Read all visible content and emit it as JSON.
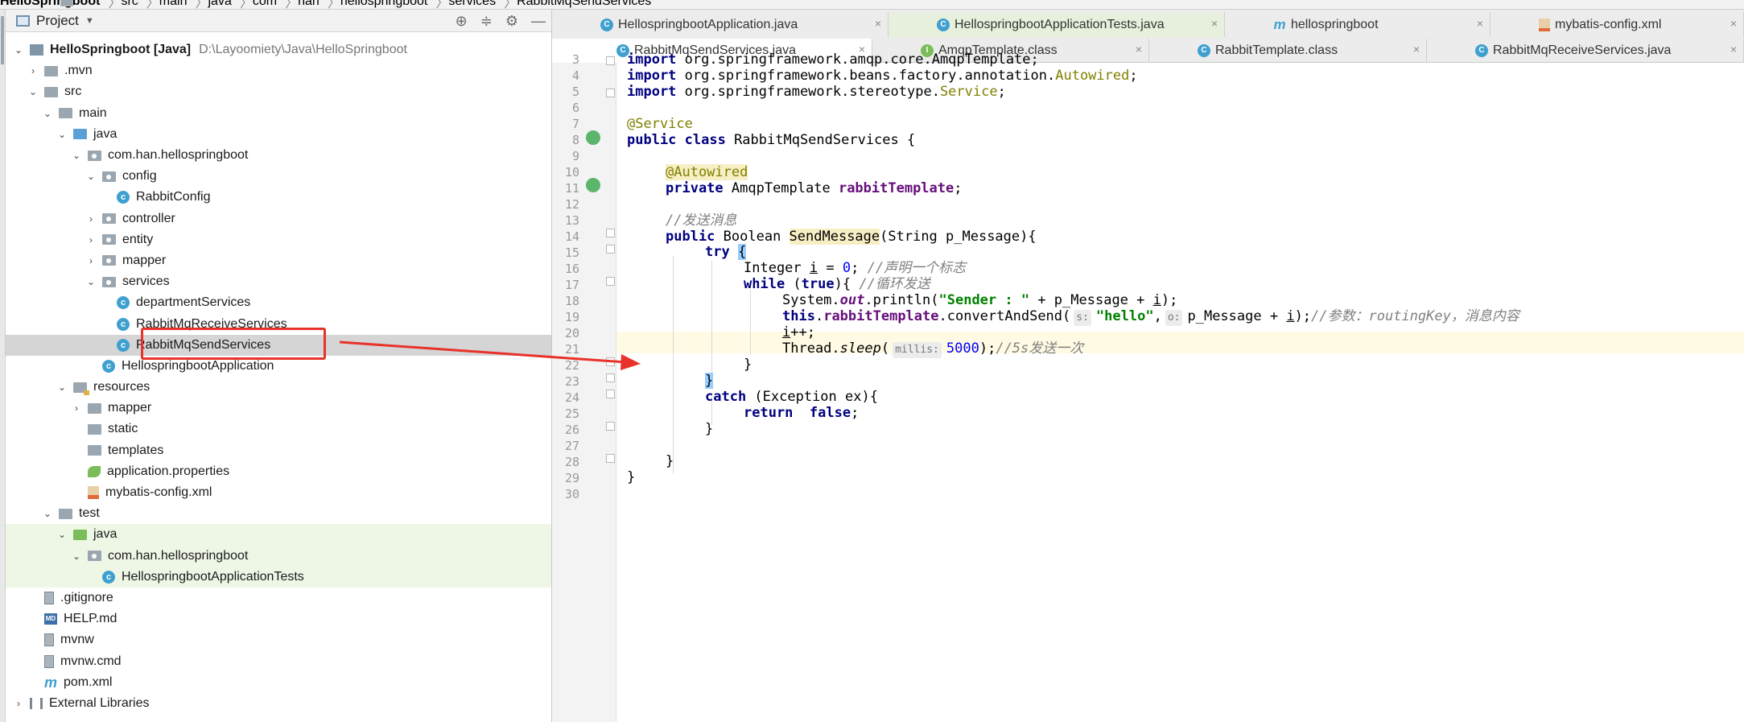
{
  "breadcrumb": [
    "HelloSpringboot",
    "src",
    "main",
    "java",
    "com",
    "han",
    "hellospringboot",
    "services",
    "RabbitMqSendServices"
  ],
  "project_panel": {
    "title": "Project",
    "tools": [
      "⊕",
      "≑",
      "⚙",
      "—"
    ]
  },
  "tree": [
    {
      "label": "HelloSpringboot [Java]",
      "path": "D:\\Layoomiety\\Java\\HelloSpringboot",
      "indent": 0,
      "arrow": "down",
      "icon": "proj",
      "bold": true
    },
    {
      "label": ".mvn",
      "indent": 1,
      "arrow": "right",
      "icon": "folder"
    },
    {
      "label": "src",
      "indent": 1,
      "arrow": "down",
      "icon": "folder"
    },
    {
      "label": "main",
      "indent": 2,
      "arrow": "down",
      "icon": "folder"
    },
    {
      "label": "java",
      "indent": 3,
      "arrow": "down",
      "icon": "folder-blue"
    },
    {
      "label": "com.han.hellospringboot",
      "indent": 4,
      "arrow": "down",
      "icon": "folder-pkg"
    },
    {
      "label": "config",
      "indent": 5,
      "arrow": "down",
      "icon": "folder-pkg"
    },
    {
      "label": "RabbitConfig",
      "indent": 6,
      "arrow": "none",
      "icon": "cls"
    },
    {
      "label": "controller",
      "indent": 5,
      "arrow": "right",
      "icon": "folder-pkg"
    },
    {
      "label": "entity",
      "indent": 5,
      "arrow": "right",
      "icon": "folder-pkg"
    },
    {
      "label": "mapper",
      "indent": 5,
      "arrow": "right",
      "icon": "folder-pkg"
    },
    {
      "label": "services",
      "indent": 5,
      "arrow": "down",
      "icon": "folder-pkg"
    },
    {
      "label": "departmentServices",
      "indent": 6,
      "arrow": "none",
      "icon": "cls"
    },
    {
      "label": "RabbitMqReceiveServices",
      "indent": 6,
      "arrow": "none",
      "icon": "cls"
    },
    {
      "label": "RabbitMqSendServices",
      "indent": 6,
      "arrow": "none",
      "icon": "cls",
      "selected": true
    },
    {
      "label": "HellospringbootApplication",
      "indent": 5,
      "arrow": "none",
      "icon": "cls"
    },
    {
      "label": "resources",
      "indent": 3,
      "arrow": "down",
      "icon": "folder-res"
    },
    {
      "label": "mapper",
      "indent": 4,
      "arrow": "right",
      "icon": "folder"
    },
    {
      "label": "static",
      "indent": 4,
      "arrow": "none",
      "icon": "folder"
    },
    {
      "label": "templates",
      "indent": 4,
      "arrow": "none",
      "icon": "folder"
    },
    {
      "label": "application.properties",
      "indent": 4,
      "arrow": "none",
      "icon": "props"
    },
    {
      "label": "mybatis-config.xml",
      "indent": 4,
      "arrow": "none",
      "icon": "xml"
    },
    {
      "label": "test",
      "indent": 2,
      "arrow": "down",
      "icon": "folder"
    },
    {
      "label": "java",
      "indent": 3,
      "arrow": "down",
      "icon": "folder-green",
      "green": true
    },
    {
      "label": "com.han.hellospringboot",
      "indent": 4,
      "arrow": "down",
      "icon": "folder-pkg",
      "green": true
    },
    {
      "label": "HellospringbootApplicationTests",
      "indent": 5,
      "arrow": "none",
      "icon": "cls",
      "green": true
    },
    {
      "label": ".gitignore",
      "indent": 1,
      "arrow": "none",
      "icon": "file"
    },
    {
      "label": "HELP.md",
      "indent": 1,
      "arrow": "none",
      "icon": "md"
    },
    {
      "label": "mvnw",
      "indent": 1,
      "arrow": "none",
      "icon": "file"
    },
    {
      "label": "mvnw.cmd",
      "indent": 1,
      "arrow": "none",
      "icon": "file"
    },
    {
      "label": "pom.xml",
      "indent": 1,
      "arrow": "none",
      "icon": "m"
    },
    {
      "label": "External Libraries",
      "indent": 0,
      "arrow": "right",
      "icon": "lib"
    }
  ],
  "tabs": {
    "row1": [
      {
        "label": "HellospringbootApplication.java",
        "icon": "cls",
        "icon_text": "C"
      },
      {
        "label": "HellospringbootApplicationTests.java",
        "icon": "cls",
        "icon_text": "C",
        "green": true
      },
      {
        "label": "hellospringboot",
        "icon": "m",
        "icon_text": "m"
      },
      {
        "label": "mybatis-config.xml",
        "icon": "xml",
        "icon_text": ""
      }
    ],
    "row2": [
      {
        "label": "RabbitMqSendServices.java",
        "icon": "cls",
        "icon_text": "C",
        "active": true
      },
      {
        "label": "AmqpTemplate.class",
        "icon": "iface",
        "icon_text": "I"
      },
      {
        "label": "RabbitTemplate.class",
        "icon": "cls",
        "icon_text": "C"
      },
      {
        "label": "RabbitMqReceiveServices.java",
        "icon": "cls",
        "icon_text": "C"
      }
    ]
  },
  "editor": {
    "line_numbers": [
      "3",
      "4",
      "5",
      "6",
      "7",
      "8",
      "9",
      "10",
      "11",
      "12",
      "13",
      "14",
      "15",
      "16",
      "17",
      "18",
      "19",
      "20",
      "21",
      "22",
      "23",
      "24",
      "25",
      "26",
      "27",
      "28",
      "29",
      "30"
    ],
    "code": {
      "l3_kw": "import",
      "l3_rest": " org.springframework.amqp.core.AmqpTemplate;",
      "l4_kw": "import",
      "l4_rest": " org.springframework.beans.factory.annotation.",
      "l4_ann": "Autowired",
      "l4_end": ";",
      "l5_kw": "import",
      "l5_rest": " org.springframework.stereotype.",
      "l5_ann": "Service",
      "l5_end": ";",
      "l7_ann": "@Service",
      "l8_kw": "public class",
      "l8_rest": " RabbitMqSendServices {",
      "l10_ann": "@Autowired",
      "l11_kw": "private",
      "l11_type": " AmqpTemplate ",
      "l11_fld": "rabbitTemplate",
      "l11_end": ";",
      "l13_cmt": "//发送消息",
      "l14_kw": "public",
      "l14_type": " Boolean ",
      "l14_meth": "SendMessage",
      "l14_rest": "(String p_Message){",
      "l15_kw": "try",
      "l15_brace": "{",
      "l16_a": "Integer ",
      "l16_var": "i",
      "l16_b": " = ",
      "l16_num": "0",
      "l16_c": "; ",
      "l16_cmt": "//声明一个标志",
      "l17_kw": "while",
      "l17_a": " (",
      "l17_kw2": "true",
      "l17_b": "){ ",
      "l17_cmt": "//循环发送",
      "l18_a": "System.",
      "l18_stat": "out",
      "l18_b": ".println(",
      "l18_str": "\"Sender : \"",
      "l18_c": " + p_Message + ",
      "l18_var": "i",
      "l18_d": ");",
      "l19_kw": "this",
      "l19_a": ".",
      "l19_fld": "rabbitTemplate",
      "l19_b": ".convertAndSend(",
      "l19_hint1": "s:",
      "l19_str": "\"hello\"",
      "l19_c": ",",
      "l19_hint2": "o:",
      "l19_d": "p_Message + ",
      "l19_var": "i",
      "l19_e": ");",
      "l19_cmt": "//参数：routingKey，消息内容",
      "l20_var": "i",
      "l20_rest": "++;",
      "l21_a": "Thread.",
      "l21_ital": "sleep",
      "l21_b": "(",
      "l21_hint": "millis:",
      "l21_num": "5000",
      "l21_c": ");",
      "l21_cmt": "//5s发送一次",
      "l22": "}",
      "l23": "}",
      "l24_kw": "catch",
      "l24_rest": " (Exception ex){",
      "l25_kw": "return",
      "l25_gap": "  ",
      "l25_kw2": "false",
      "l25_end": ";",
      "l26": "}",
      "l28": "}",
      "l29": "}"
    }
  },
  "colors": {
    "keyword": "#000080",
    "annotation": "#808000",
    "field": "#660e7a",
    "string": "#008000",
    "number": "#0000ff",
    "comment": "#808080",
    "highlight_box": "#e8322a"
  }
}
